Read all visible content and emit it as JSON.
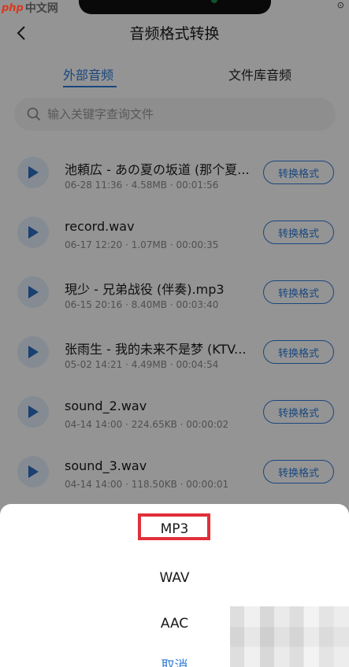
{
  "watermark": {
    "logo": "php",
    "text": "中文网"
  },
  "status": {
    "glyph": "⊙"
  },
  "header": {
    "title": "音频格式转换"
  },
  "tabs": [
    {
      "label": "外部音频",
      "active": true
    },
    {
      "label": "文件库音频",
      "active": false
    }
  ],
  "search": {
    "placeholder": "输入关键字查询文件"
  },
  "items": [
    {
      "name": "池頼広 - あの夏の坂道 (那个夏...",
      "meta": "06-28 11:36 · 4.58MB · 00:01:56",
      "action": "转换格式"
    },
    {
      "name": "record.wav",
      "meta": "06-17 12:20 · 1.07MB · 00:00:35",
      "action": "转换格式"
    },
    {
      "name": "現少 - 兄弟战役 (伴奏).mp3",
      "meta": "06-15 20:16 · 8.40MB · 00:03:40",
      "action": "转换格式"
    },
    {
      "name": "张雨生 - 我的未来不是梦 (KTV...",
      "meta": "05-02 14:21 · 4.49MB · 00:04:54",
      "action": "转换格式"
    },
    {
      "name": "sound_2.wav",
      "meta": "04-14 14:00 · 224.65KB · 00:00:02",
      "action": "转换格式"
    },
    {
      "name": "sound_3.wav",
      "meta": "04-14 14:00 · 118.50KB · 00:00:01",
      "action": "转换格式"
    }
  ],
  "sheet": {
    "options": [
      "MP3",
      "WAV",
      "AAC"
    ],
    "cancel": "取消"
  },
  "colors": {
    "accent": "#2e7ad8",
    "highlight": "#e0303a"
  }
}
